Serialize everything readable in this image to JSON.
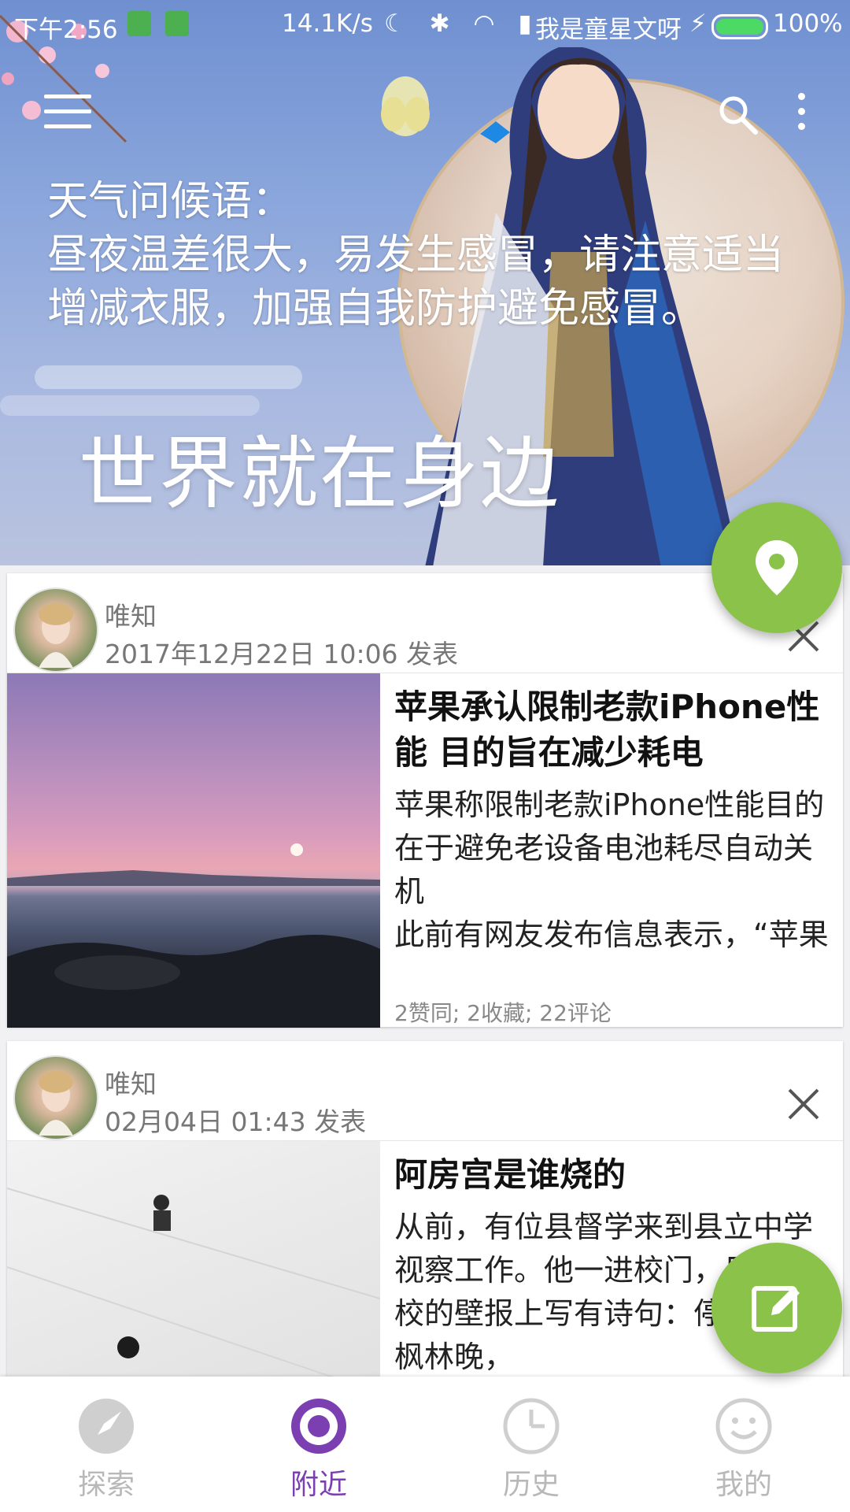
{
  "status_bar": {
    "time": "下午2:56",
    "net_speed": "14.1K/s",
    "carrier": "我是童星文呀",
    "battery": "100%"
  },
  "header": {
    "greeting_title": "天气问候语：",
    "greeting_text": "昼夜温差很大，易发生感冒，请注意适当增减衣服，加强自我防护避免感冒。",
    "slogan": "世界就在身边"
  },
  "feed": {
    "cards": [
      {
        "author": "唯知",
        "time": "2017年12月22日 10:06 发表",
        "title": "苹果承认限制老款iPhone性能 目的旨在减少耗电",
        "summary": "苹果称限制老款iPhone性能目的在于避免老设备电池耗尽自动关机\n此前有网友发布信息表示，“苹果故意限制了旧款iPhone性",
        "stats": "2赞同; 2收藏; 22评论"
      },
      {
        "author": "唯知",
        "time": "02月04日 01:43 发表",
        "title": "阿房宫是谁烧的",
        "summary": "从前，有位县督学来到县立中学视察工作。他一进校门，见到该校的壁报上写有诗句：停车坐爱枫林晚，"
      }
    ]
  },
  "bottom_nav": [
    {
      "label": "探索",
      "icon": "compass-icon",
      "active": false
    },
    {
      "label": "附近",
      "icon": "nearby-icon",
      "active": true
    },
    {
      "label": "历史",
      "icon": "clock-icon",
      "active": false
    },
    {
      "label": "我的",
      "icon": "smiley-icon",
      "active": false
    }
  ],
  "colors": {
    "fab": "#8bc34a",
    "active_nav": "#7b3fb2",
    "inactive_nav": "#b8b8b8"
  }
}
